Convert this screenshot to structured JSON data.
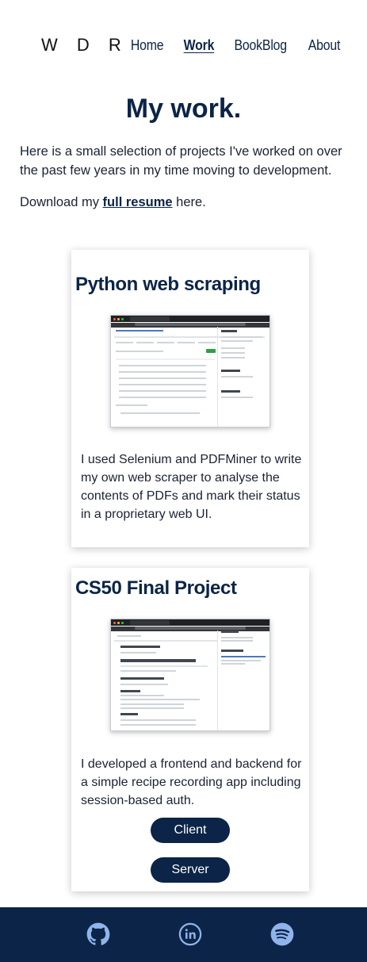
{
  "nav": {
    "logo": "W D R",
    "items": [
      "Home",
      "Work",
      "BookBlog",
      "About"
    ],
    "active": "Work"
  },
  "page": {
    "title": "My work.",
    "intro": "Here is a small selection of projects I've worked on over the past few years in my time moving to development.",
    "download_prefix": "Download my ",
    "download_link": "full resume",
    "download_suffix": " here."
  },
  "projects": [
    {
      "title": "Python web scraping",
      "description": "I used Selenium and PDFMiner to write my own web scraper to analyse the contents of PDFs and mark their status in a proprietary web UI."
    },
    {
      "title": "CS50 Final Project",
      "description": "I developed a frontend and backend for a simple recipe recording app including session-based auth.",
      "buttons": [
        "Client",
        "Server"
      ]
    }
  ],
  "footer": {
    "icons": [
      "github-icon",
      "linkedin-icon",
      "spotify-icon"
    ]
  },
  "colors": {
    "navy": "#0b2447",
    "icon": "#8fb3ea"
  }
}
